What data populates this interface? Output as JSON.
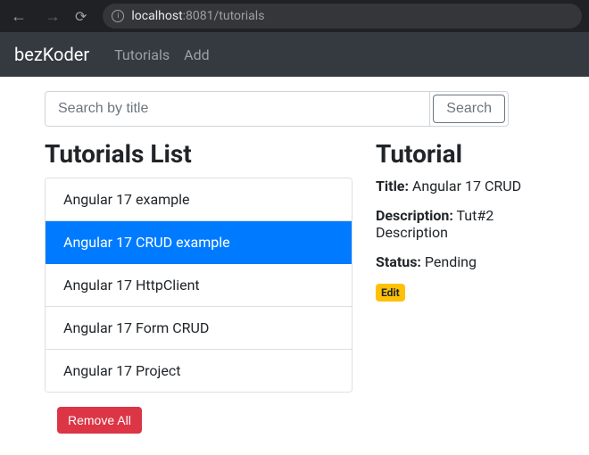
{
  "browser": {
    "url_host": "localhost",
    "url_port_path": ":8081/tutorials"
  },
  "navbar": {
    "brand": "bezKoder",
    "links": [
      "Tutorials",
      "Add"
    ]
  },
  "search": {
    "placeholder": "Search by title",
    "button": "Search"
  },
  "list": {
    "heading": "Tutorials List",
    "items": [
      "Angular 17 example",
      "Angular 17 CRUD example",
      "Angular 17 HttpClient",
      "Angular 17 Form CRUD",
      "Angular 17 Project"
    ],
    "active_index": 1,
    "remove_all": "Remove All"
  },
  "detail": {
    "heading": "Tutorial",
    "title_label": "Title:",
    "title_value": "Angular 17 CRUD",
    "description_label": "Description:",
    "description_value": "Tut#2 Description",
    "status_label": "Status:",
    "status_value": "Pending",
    "edit": "Edit"
  }
}
